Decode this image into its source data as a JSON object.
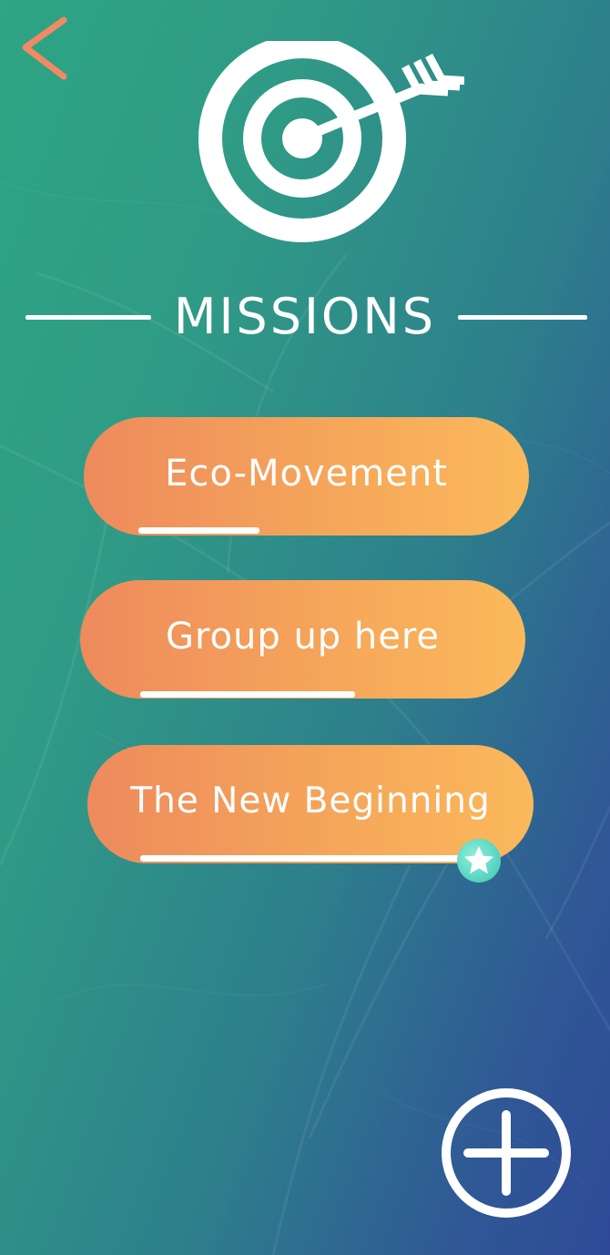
{
  "header": {
    "back_icon": "chevron-left-icon",
    "hero_icon": "target-arrow-icon",
    "title": "MISSIONS"
  },
  "missions": [
    {
      "label": "Eco-Movement",
      "progress": 0.27,
      "starred": false
    },
    {
      "label": "Group up here",
      "progress": 0.48,
      "starred": false
    },
    {
      "label": "The New Beginning",
      "progress": 0.74,
      "starred": true
    }
  ],
  "fab": {
    "icon": "plus-circle-icon"
  },
  "colors": {
    "accent_back": "#f08a64",
    "pill_start": "#ee8a5d",
    "pill_end": "#fbb95b",
    "star_badge": "#5fd9c5",
    "bg_start": "#2ea584",
    "bg_end": "#2f4a98"
  }
}
